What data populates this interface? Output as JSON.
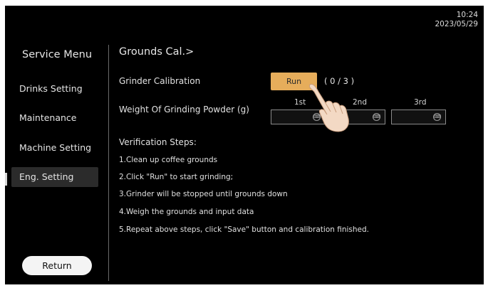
{
  "status": {
    "time": "10:24",
    "date": "2023/05/29"
  },
  "sidebar": {
    "title": "Service Menu",
    "items": [
      {
        "label": "Drinks Setting"
      },
      {
        "label": "Maintenance"
      },
      {
        "label": "Machine Setting"
      },
      {
        "label": "Eng. Setting",
        "active": true
      }
    ],
    "return_label": "Return"
  },
  "main": {
    "title": "Grounds Cal.>",
    "grinder_calibration": {
      "label": "Grinder Calibration",
      "button_label": "Run",
      "progress": "( 0 / 3 )"
    },
    "weight": {
      "label": "Weight Of Grinding Powder (g)",
      "columns": [
        "1st",
        "2nd",
        "3rd"
      ],
      "values": [
        "",
        "",
        ""
      ]
    },
    "verification": {
      "title": "Verification Steps:",
      "steps": [
        "1.Clean up coffee grounds",
        "2.Click \"Run\" to start grinding;",
        "3.Grinder will be stopped until grounds down",
        "4.Weigh the grounds and input data",
        "5.Repeat above steps, click \"Save\" button and calibration finished."
      ]
    }
  },
  "colors": {
    "accent": "#e6ad5b",
    "background": "#000000"
  },
  "icons": {
    "keyboard": "keyboard-icon",
    "pointer": "hand-pointer-icon"
  }
}
